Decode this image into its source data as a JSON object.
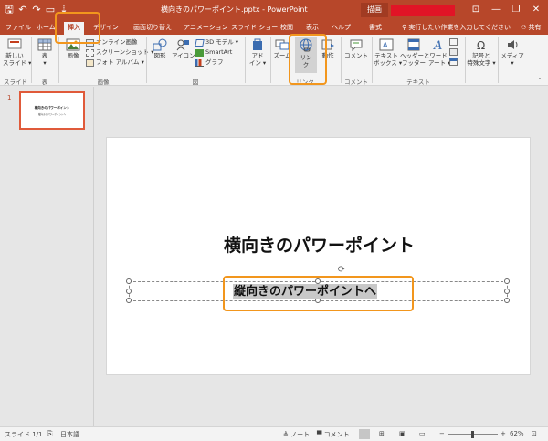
{
  "window": {
    "document_title": "横向きのパワーポイント.pptx  -  PowerPoint",
    "context_tab": "描画",
    "minimize_glyph": "—",
    "restore_glyph": "❐",
    "close_glyph": "✕"
  },
  "qat": {
    "save": "🖫",
    "undo": "↶",
    "redo": "↷",
    "present": "▭",
    "more": "⇣"
  },
  "tabs": {
    "file": "ファイル",
    "home": "ホーム",
    "insert": "挿入",
    "design": "デザイン",
    "transitions": "画面切り替え",
    "animations": "アニメーション",
    "slideshow": "スライド ショー",
    "review": "校閲",
    "view": "表示",
    "help": "ヘルプ",
    "format": "書式",
    "tell_me": "実行したい作業を入力してください",
    "share": "共有"
  },
  "ribbon": {
    "new_slide": [
      "新しい",
      "スライド ▾"
    ],
    "table": [
      "表",
      "▾"
    ],
    "picture": "画像",
    "online_pictures": "オンライン画像",
    "screenshot": "スクリーンショット ▾",
    "photo_album": "フォト アルバム ▾",
    "shapes": "図形",
    "icons": "アイコン",
    "model_3d": "3D モデル ▾",
    "smartart": "SmartArt",
    "chart": "グラフ",
    "addins": [
      "アド",
      "イン ▾"
    ],
    "zoom": "ズーム",
    "link": [
      "リン",
      "ク"
    ],
    "action": "動作",
    "comment": "コメント",
    "textbox": [
      "テキスト",
      "ボックス ▾"
    ],
    "header_footer": [
      "ヘッダーと",
      "フッター"
    ],
    "wordart": [
      "ワード",
      "アート ▾"
    ],
    "symbols": [
      "記号と",
      "特殊文字 ▾"
    ],
    "media": [
      "メディア",
      "▾"
    ],
    "groups": {
      "slides": "スライド",
      "tables": "表",
      "images": "画像",
      "illustrations": "図",
      "links": "リンク",
      "comments": "コメント",
      "text": "テキスト"
    }
  },
  "thumbnail": {
    "number": "1",
    "title": "横向きのパワーポイント",
    "subtitle": "縦向きのパワーポイントへ"
  },
  "slide": {
    "title": "横向きのパワーポイント",
    "subtitle": "縦向きのパワーポイントへ"
  },
  "statusbar": {
    "slide_info": "スライド 1/1",
    "language": "日本語",
    "notes": "≜ ノート",
    "comments": "▀ コメント",
    "zoom_out": "−",
    "zoom_in": "+",
    "zoom": "62%"
  },
  "zoom_level_percent": 62,
  "colors": {
    "accent": "#b7472a",
    "highlight": "#f2961d",
    "account": "#e11426"
  }
}
